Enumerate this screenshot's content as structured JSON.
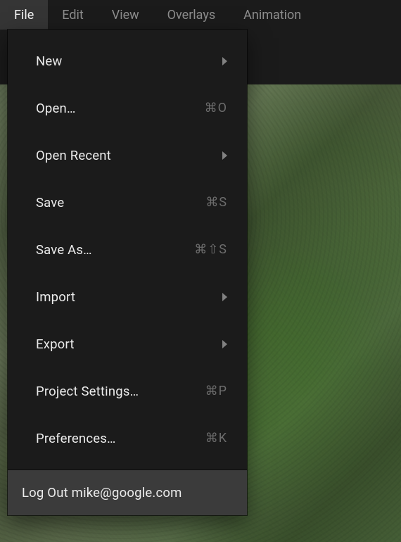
{
  "menubar": {
    "items": [
      {
        "label": "File",
        "active": true
      },
      {
        "label": "Edit",
        "active": false
      },
      {
        "label": "View",
        "active": false
      },
      {
        "label": "Overlays",
        "active": false
      },
      {
        "label": "Animation",
        "active": false
      }
    ]
  },
  "dropdown": {
    "items": [
      {
        "label": "New",
        "submenu": true
      },
      {
        "label": "Open…",
        "shortcut": "⌘O"
      },
      {
        "label": "Open Recent",
        "submenu": true
      },
      {
        "label": "Save",
        "shortcut": "⌘S"
      },
      {
        "label": "Save As…",
        "shortcut": "⌘⇧S"
      },
      {
        "label": "Import",
        "submenu": true
      },
      {
        "label": "Export",
        "submenu": true
      },
      {
        "label": "Project Settings…",
        "shortcut": "⌘P"
      },
      {
        "label": "Preferences…",
        "shortcut": "⌘K"
      }
    ],
    "logout_label": "Log Out mike@google.com"
  }
}
